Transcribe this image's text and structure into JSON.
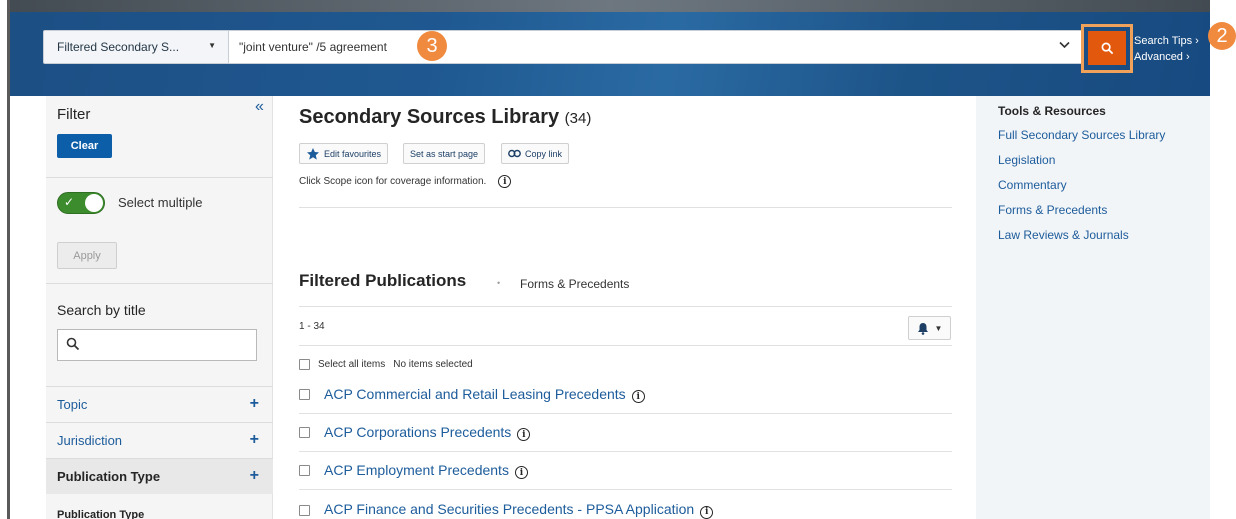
{
  "header": {
    "scope_label": "Filtered Secondary S...",
    "search_query": "\"joint venture\" /5 agreement",
    "search_tips": "Search Tips",
    "advanced": "Advanced",
    "search_tips_chevron": "›",
    "advanced_chevron": "›",
    "marker_search": "3",
    "marker_button": "2",
    "search_icon": "search-icon",
    "accent_color": "#e2590e"
  },
  "sidebar": {
    "title": "Filter",
    "collapse_glyph": "«",
    "clear_label": "Clear",
    "select_multiple_label": "Select multiple",
    "select_multiple_on": true,
    "apply_label": "Apply",
    "search_by_title_label": "Search by title",
    "search_by_title_value": "",
    "facets": [
      {
        "label": "Topic",
        "state": "+"
      },
      {
        "label": "Jurisdiction",
        "state": "+"
      },
      {
        "label": "Publication Type",
        "state": "+"
      }
    ],
    "facet_sub_label": "Publication Type"
  },
  "main": {
    "title": "Secondary Sources Library",
    "count": "(34)",
    "actions": [
      {
        "label": "Edit favourites",
        "icon": "star-icon"
      },
      {
        "label": "Set as start page",
        "icon": ""
      },
      {
        "label": "Copy link",
        "icon": "link-icon"
      }
    ],
    "scope_note": "Click Scope icon for coverage information.",
    "filtered_title": "Filtered Publications",
    "filtered_separator": "•",
    "filtered_subtitle": "Forms & Precedents",
    "range": "1 - 34",
    "select_all_label": "Select all items",
    "selected_status": "No items selected",
    "publications": [
      "ACP Commercial and Retail Leasing Precedents",
      "ACP Corporations Precedents",
      "ACP Employment Precedents",
      "ACP Finance and Securities Precedents - PPSA Application"
    ]
  },
  "tools": {
    "title": "Tools & Resources",
    "links": [
      "Full Secondary Sources Library",
      "Legislation",
      "Commentary",
      "Forms & Precedents",
      "Law Reviews & Journals"
    ]
  }
}
